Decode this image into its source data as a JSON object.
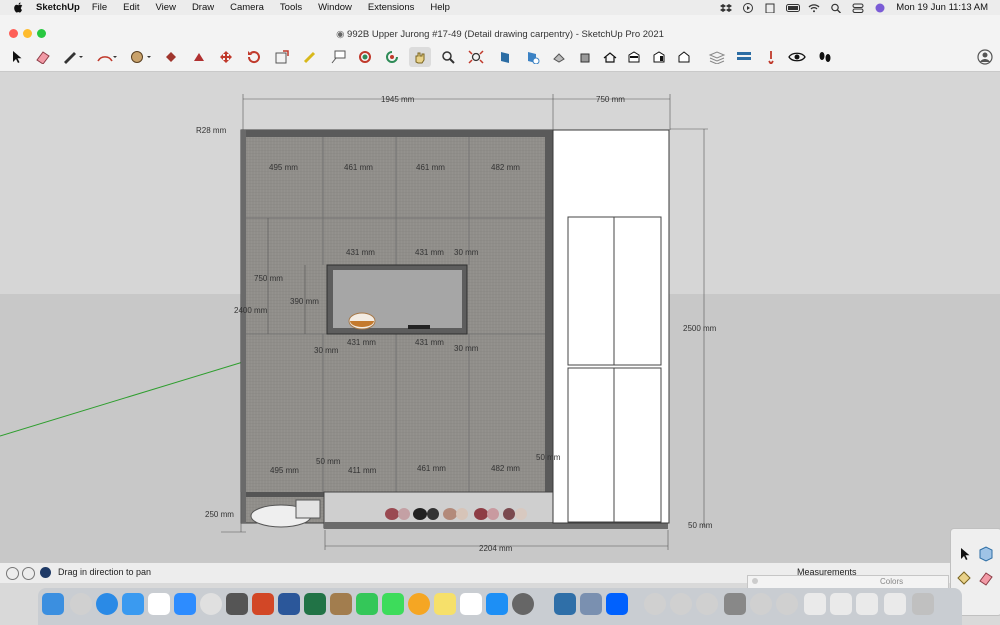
{
  "menubar": {
    "app_name": "SketchUp",
    "items": [
      "File",
      "Edit",
      "View",
      "Draw",
      "Camera",
      "Tools",
      "Window",
      "Extensions",
      "Help"
    ],
    "clock": "Mon 19 Jun  11:13 AM"
  },
  "window": {
    "title": "992B Upper Jurong #17-49 (Detail drawing carpentry) - SketchUp Pro 2021"
  },
  "toolbar": {
    "tools": [
      "select-icon",
      "eraser-icon",
      "pencil-icon",
      "arc-icon",
      "paint-bucket-icon",
      "push-pull-icon",
      "follow-me-icon",
      "move-icon",
      "rotate-icon",
      "scale-icon",
      "tape-measure-icon",
      "text-icon",
      "orbit-icon",
      "pan-icon",
      "zoom-icon",
      "zoom-extents-icon",
      "section-plane-icon",
      "section-display-icon",
      "x-ray-icon",
      "components-icon",
      "home-view-icon",
      "front-view-icon",
      "right-view-icon",
      "back-view-icon",
      "layers-icon",
      "model-info-icon",
      "extension-icon",
      "eye-icon",
      "walk-icon",
      "account-icon"
    ],
    "active_tool": "pan-icon"
  },
  "drawing": {
    "dimensions": {
      "top_width": "1945 mm",
      "top_right": "750 mm",
      "radius": "R28 mm",
      "col1_top": "495 mm",
      "col2_top": "461 mm",
      "col3_top": "461 mm",
      "col4_top": "482 mm",
      "niche_w1": "431 mm",
      "niche_w2": "431 mm",
      "niche_side": "30 mm",
      "height_750": "750 mm",
      "height_390": "390 mm",
      "left_height": "2400 mm",
      "niche_b1": "431 mm",
      "niche_b2": "431 mm",
      "niche_bside_l": "30 mm",
      "niche_bside_r": "30 mm",
      "overall_height": "2500 mm",
      "col1_bot": "495 mm",
      "col2_bot": "411 mm",
      "col3_bot": "461 mm",
      "col4_bot": "482 mm",
      "gap_50_a": "50 mm",
      "gap_50_b": "50 mm",
      "plinth_h": "250 mm",
      "floor_50": "50 mm",
      "bottom_width": "2204 mm"
    }
  },
  "statusbar": {
    "hint": "Drag in direction to pan",
    "measurements_label": "Measurements"
  },
  "colors_panel": {
    "title": "Colors"
  },
  "colors": {
    "cabinet_fill": "#8e8c88",
    "cabinet_frame": "#525252",
    "wall": "#ffffff",
    "ground": "#c9c9c9",
    "sky": "#d6d6d6",
    "axis_green": "#2e9e2e"
  }
}
